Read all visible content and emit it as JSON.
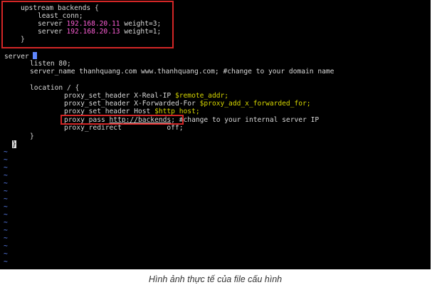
{
  "editor": {
    "upstream_open": "upstream backends {",
    "least_conn": "least_conn;",
    "server_kw": "server",
    "server1_ip": "192.168.20.11",
    "server1_weight": "weight=3;",
    "server2_ip": "192.168.20.13",
    "server2_weight": "weight=1;",
    "upstream_close": "}",
    "server_block_open": "server",
    "listen": "listen 80;",
    "server_name": "server_name thanhquang.com www.thanhquang.com; #change to your domain name",
    "location_open": "location / {",
    "xrealip_directive": "proxy_set_header X-Real-IP",
    "xrealip_var": "$remote_addr;",
    "xfwd_directive": "proxy_set_header X-Forwarded-For",
    "xfwd_var": "$proxy_add_x_forwarded_for;",
    "host_directive": "proxy_set_header Host",
    "host_var": "$http_host;",
    "proxy_pass_kw": "proxy_pass",
    "proxy_pass_url": "http://backends",
    "proxy_pass_end": ";",
    "proxy_pass_comment": "#change to your internal server IP",
    "proxy_redirect": "proxy_redirect           off;",
    "location_close": "}",
    "server_close": "}",
    "tilde": "~"
  },
  "caption": "Hình ảnh thực tế của file cấu hình",
  "colors": {
    "background": "#000000",
    "text": "#d8d8d8",
    "ip_highlight": "#ff5fd7",
    "variable_highlight": "#d7d700",
    "tilde_color": "#5f87ff",
    "annotation_box": "#d32626"
  }
}
